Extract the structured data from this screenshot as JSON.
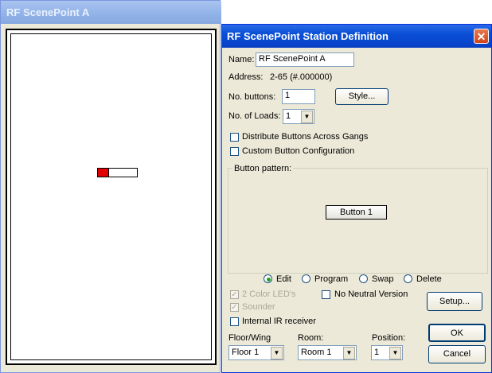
{
  "back_window": {
    "title": "RF ScenePoint A"
  },
  "dialog": {
    "title": "RF ScenePoint Station Definition",
    "close_symbol": "✕",
    "name_label": "Name:",
    "name_value": "RF ScenePoint A",
    "address_label": "Address:",
    "address_value": "2-65 (#.000000)",
    "buttons_label": "No. buttons:",
    "buttons_value": "1",
    "style_button": "Style...",
    "loads_label": "No. of Loads:",
    "loads_value": "1",
    "distribute_label": "Distribute Buttons Across Gangs",
    "custom_label": "Custom Button Configuration",
    "pattern_label": "Button pattern:",
    "pattern_button": "Button 1",
    "modes": [
      {
        "label": "Edit",
        "selected": true
      },
      {
        "label": "Program",
        "selected": false
      },
      {
        "label": "Swap",
        "selected": false
      },
      {
        "label": "Delete",
        "selected": false
      }
    ],
    "two_color_label": "2 Color LED's",
    "sounder_label": "Sounder",
    "ir_label": "Internal IR receiver",
    "no_neutral_label": "No Neutral Version",
    "setup_button": "Setup...",
    "floor_label": "Floor/Wing",
    "floor_value": "Floor 1",
    "room_label": "Room:",
    "room_value": "Room 1",
    "position_label": "Position:",
    "position_value": "1",
    "ok_button": "OK",
    "cancel_button": "Cancel",
    "check_mark": "✓",
    "arrow_glyph": "▼"
  },
  "colors": {
    "titlebar_active": "#0a4fd6",
    "titlebar_inactive": "#90b2e8",
    "led_red": "#e00000",
    "radio_dot": "#21a121"
  }
}
